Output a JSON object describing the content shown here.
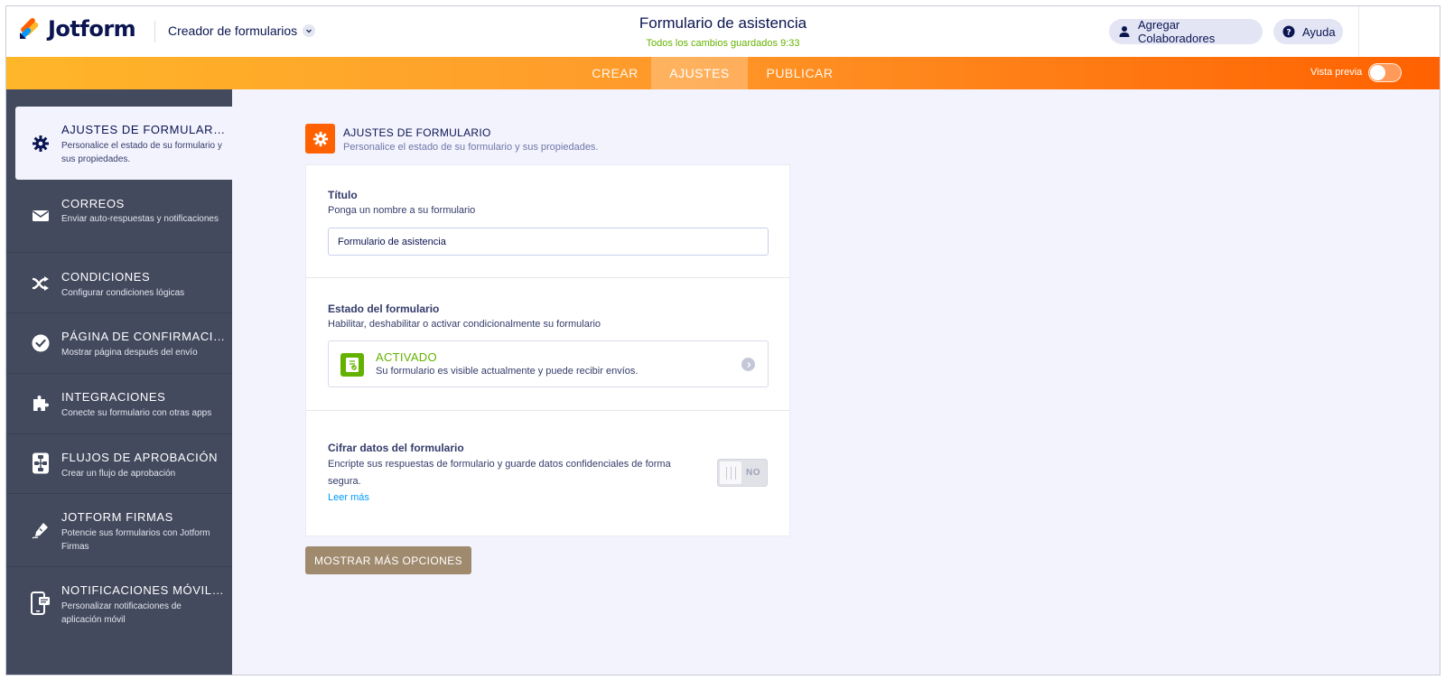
{
  "header": {
    "brand": "Jotform",
    "builder_menu": "Creador de formularios",
    "form_title": "Formulario de asistencia",
    "save_status": "Todos los cambios guardados 9:33",
    "collaborators_label": "Agregar Colaboradores",
    "help_label": "Ayuda"
  },
  "nav": {
    "tabs": [
      {
        "label": "CREAR",
        "active": false
      },
      {
        "label": "AJUSTES",
        "active": true
      },
      {
        "label": "PUBLICAR",
        "active": false
      }
    ],
    "preview_label": "Vista previa",
    "preview_on": false
  },
  "sidebar": {
    "items": [
      {
        "title": "AJUSTES DE FORMULARIO",
        "desc": "Personalice el estado de su formulario y sus propiedades.",
        "icon": "gear-icon",
        "active": true
      },
      {
        "title": "CORREOS",
        "desc": "Enviar auto-respuestas y notificaciones",
        "icon": "envelope-icon",
        "active": false
      },
      {
        "title": "CONDICIONES",
        "desc": "Configurar condiciones lógicas",
        "icon": "shuffle-icon",
        "active": false
      },
      {
        "title": "PÁGINA DE CONFIRMACIÓN",
        "desc": "Mostrar página después del envío",
        "icon": "check-circle-icon",
        "active": false
      },
      {
        "title": "INTEGRACIONES",
        "desc": "Conecte su formulario con otras apps",
        "icon": "puzzle-icon",
        "active": false
      },
      {
        "title": "FLUJOS DE APROBACIÓN",
        "desc": "Crear un flujo de aprobación",
        "icon": "flow-icon",
        "active": false
      },
      {
        "title": "JOTFORM FIRMAS",
        "desc": "Potencie sus formularios con Jotform Firmas",
        "icon": "pen-icon",
        "active": false
      },
      {
        "title": "NOTIFICACIONES MÓVILES",
        "desc": "Personalizar notificaciones de aplicación móvil",
        "icon": "mobile-icon",
        "active": false
      }
    ]
  },
  "main": {
    "section_title": "AJUSTES DE FORMULARIO",
    "section_subtitle": "Personalice el estado de su formulario y sus propiedades.",
    "title_field": {
      "label": "Título",
      "help": "Ponga un nombre a su formulario",
      "value": "Formulario de asistencia"
    },
    "status_field": {
      "label": "Estado del formulario",
      "help": "Habilitar, deshabilitar o activar condicionalmente su formulario",
      "status": "ACTIVADO",
      "status_desc": "Su formulario es visible actualmente y puede recibir envíos."
    },
    "encrypt_field": {
      "label": "Cifrar datos del formulario",
      "help": "Encripte sus respuestas de formulario y guarde datos confidenciales de forma segura.",
      "link": "Leer más",
      "toggle_label": "NO"
    },
    "more_button": "MOSTRAR MÁS OPCIONES"
  },
  "colors": {
    "brand_orange": "#ff6100",
    "accent_yellow": "#ffb629",
    "sidebar_bg": "#434a5e",
    "active_green": "#64b200",
    "link_blue": "#0099ff",
    "more_button": "#a08a6e"
  }
}
